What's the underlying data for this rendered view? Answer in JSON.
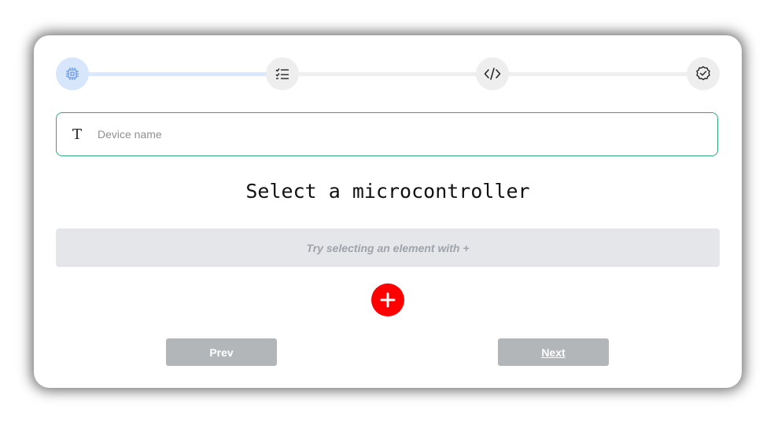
{
  "stepper": {
    "steps": [
      {
        "icon": "chip-icon",
        "active": true
      },
      {
        "icon": "checklist-icon",
        "active": false
      },
      {
        "icon": "code-icon",
        "active": false
      },
      {
        "icon": "check-badge-icon",
        "active": false
      }
    ]
  },
  "device_name": {
    "icon": "text-t-icon",
    "icon_glyph": "T",
    "value": "",
    "placeholder": "Device name"
  },
  "main": {
    "heading": "Select a microcontroller",
    "empty_hint": "Try selecting an element with +"
  },
  "add_button": {
    "icon": "plus-icon"
  },
  "navigation": {
    "prev_label": "Prev",
    "next_label": "Next"
  },
  "colors": {
    "accent_active_step": "#d8e6fb",
    "input_border": "#2fa77a",
    "add_button": "#ff0000",
    "nav_button": "#b3b6b9"
  }
}
